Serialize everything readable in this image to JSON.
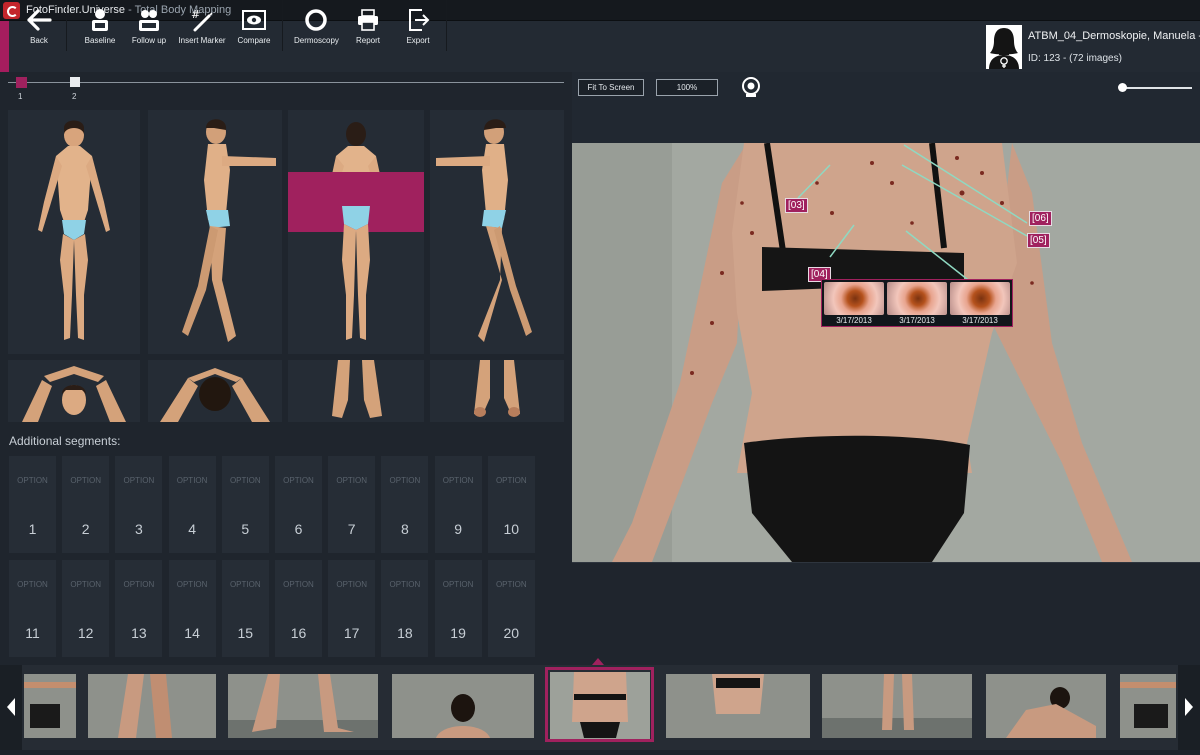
{
  "window": {
    "app_name": "FotoFinder.Universe",
    "subtitle": " - Total Body Mapping"
  },
  "toolbar": {
    "back": "Back",
    "baseline": "Baseline",
    "follow_up": "Follow up",
    "insert_marker": "Insert Marker",
    "compare": "Compare",
    "dermoscopy": "Dermoscopy",
    "report": "Report",
    "export": "Export"
  },
  "patient": {
    "name": "ATBM_04_Dermoskopie, Manuela - 3...",
    "id_line": "ID: 123 - (72 images)"
  },
  "timeline": {
    "points": [
      "1",
      "2"
    ]
  },
  "additional_segments": {
    "title": "Additional segments:",
    "option_label": "OPTION",
    "options": [
      "1",
      "2",
      "3",
      "4",
      "5",
      "6",
      "7",
      "8",
      "9",
      "10",
      "11",
      "12",
      "13",
      "14",
      "15",
      "16",
      "17",
      "18",
      "19",
      "20"
    ]
  },
  "viewer": {
    "fit_label": "Fit To Screen",
    "zoom_label": "100%",
    "markers": [
      "[03]",
      "[04]",
      "[05]",
      "[06]"
    ],
    "popup_dates": [
      "3/17/2013",
      "3/17/2013",
      "3/17/2013"
    ]
  },
  "colors": {
    "accent": "#a0215e",
    "background": "#1d2229",
    "marker_line": "#8fd9c2"
  },
  "icons": [
    "back-arrow-icon",
    "baseline-icon",
    "follow-up-icon",
    "insert-marker-icon",
    "compare-icon",
    "dermoscopy-icon",
    "report-icon",
    "export-icon",
    "camera-icon",
    "chevron-left-icon",
    "chevron-right-icon"
  ]
}
